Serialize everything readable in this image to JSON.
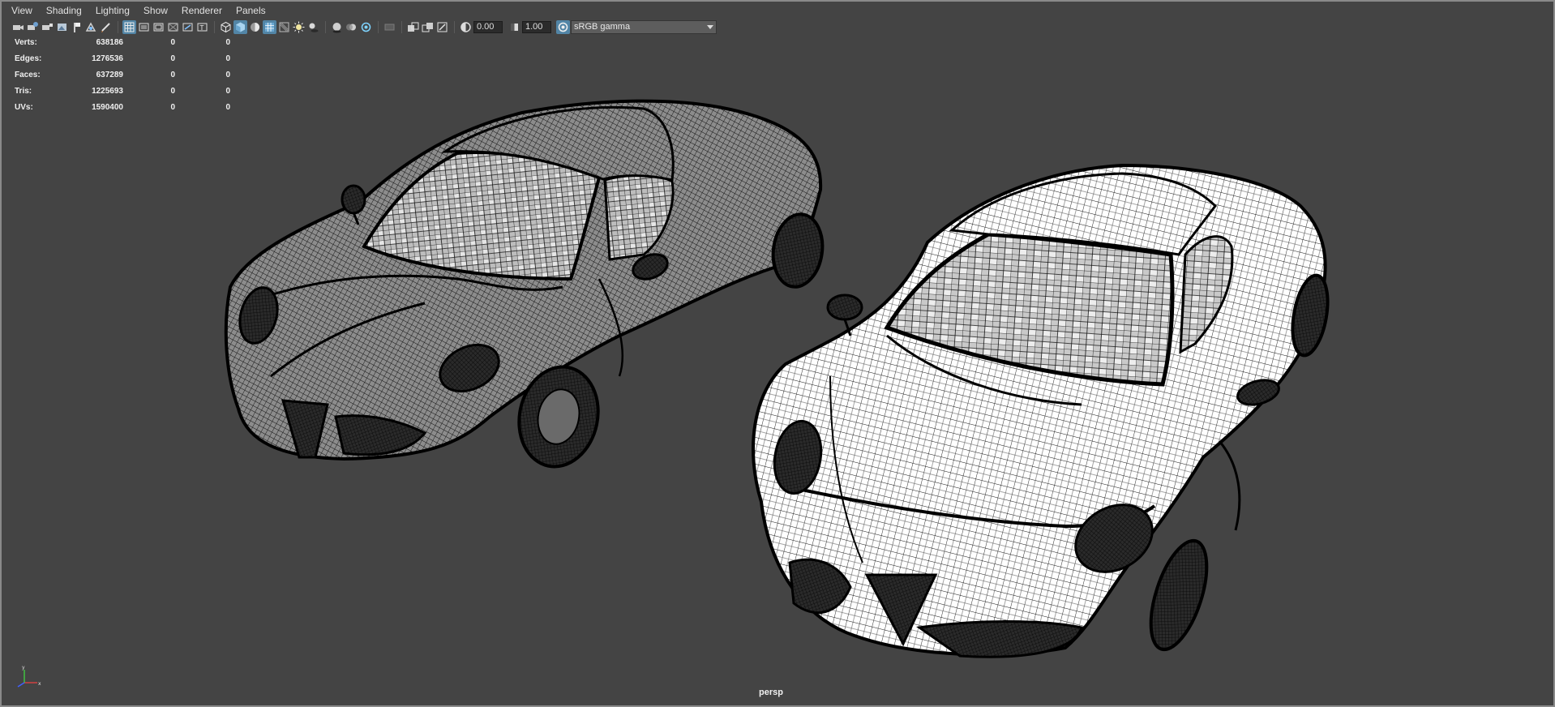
{
  "menu": [
    "View",
    "Shading",
    "Lighting",
    "Show",
    "Renderer",
    "Panels"
  ],
  "toolbar": {
    "exposure_value": "0.00",
    "gamma_value": "1.00",
    "color_space": "sRGB gamma",
    "icons": [
      "camera-icon",
      "camera-attributes-icon",
      "bookmark-icon",
      "image-plane-icon",
      "grease-pencil-icon",
      "grid-icon",
      "film-gate-icon",
      "resolution-gate-icon",
      "gate-mask-icon",
      "field-chart-icon",
      "safe-action-icon",
      "safe-title-icon",
      "wireframe-icon",
      "smooth-shade-icon",
      "textured-icon",
      "wireframe-on-shaded-icon",
      "use-lights-icon",
      "shadows-icon",
      "ambient-occlusion-icon",
      "motion-blur-icon",
      "isolate-select-icon",
      "xray-icon",
      "xray-joints-icon",
      "xray-active-icon",
      "exposure-icon",
      "gamma-icon",
      "color-management-icon"
    ]
  },
  "hud": {
    "rows": [
      {
        "label": "Verts:",
        "v1": "638186",
        "v2": "0",
        "v3": "0"
      },
      {
        "label": "Edges:",
        "v1": "1276536",
        "v2": "0",
        "v3": "0"
      },
      {
        "label": "Faces:",
        "v1": "637289",
        "v2": "0",
        "v3": "0"
      },
      {
        "label": "Tris:",
        "v1": "1225693",
        "v2": "0",
        "v3": "0"
      },
      {
        "label": "UVs:",
        "v1": "1590400",
        "v2": "0",
        "v3": "0"
      }
    ]
  },
  "viewport": {
    "camera": "persp",
    "background_color": "#444444",
    "axis": {
      "x_color": "#d04040",
      "y_color": "#40c040",
      "z_color": "#4060ff"
    }
  }
}
